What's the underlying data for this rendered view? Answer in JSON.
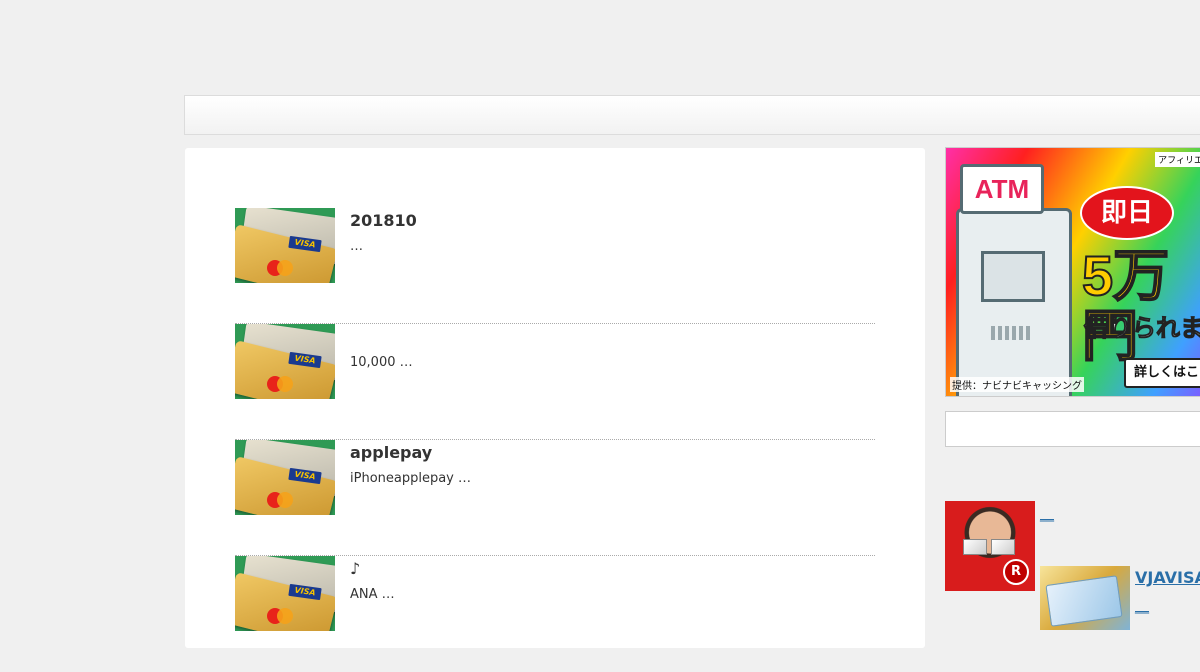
{
  "posts": [
    {
      "title": "201810",
      "excerpt": " …"
    },
    {
      "title": "",
      "excerpt": "10,000 …"
    },
    {
      "title": "applepay",
      "excerpt": "iPhoneapplepay …"
    },
    {
      "title": "♪",
      "excerpt": "ANA …"
    }
  ],
  "card_thumbnail": {
    "card_brand": "VISA"
  },
  "sidebar": {
    "ad": {
      "corner_label": "アフィリエ",
      "sign": "ATM",
      "bubble": "即日",
      "headline": "5万円",
      "subline": "借りられまし",
      "button": "詳しくはこち",
      "credit": "提供：ナビナビキャッシング"
    },
    "search": {
      "placeholder": ""
    },
    "links": [
      {
        "label": "__",
        "badge": "R"
      },
      {
        "label": "VJAVISA"
      },
      {
        "label": "__"
      }
    ]
  },
  "colors": {
    "background": "#f0f0f0",
    "link": "#2a6fa8",
    "content_bg": "#ffffff"
  }
}
